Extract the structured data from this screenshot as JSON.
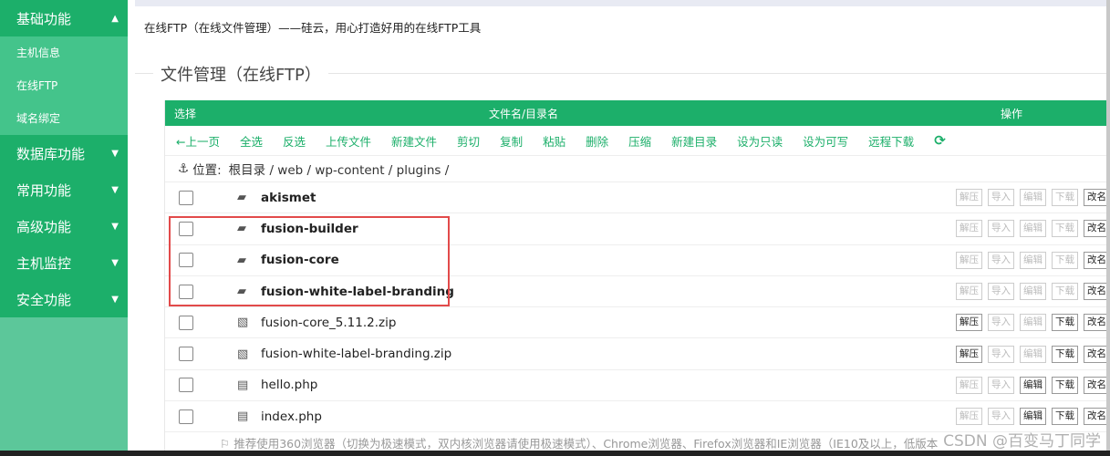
{
  "sidebar": {
    "active_header": "基础功能",
    "active_items": [
      "主机信息",
      "在线FTP",
      "域名绑定"
    ],
    "categories": [
      "数据库功能",
      "常用功能",
      "高级功能",
      "主机监控",
      "安全功能"
    ]
  },
  "page": {
    "title": "在线FTP（在线文件管理）——硅云，用心打造好用的在线FTP工具",
    "section_title": "文件管理（在线FTP）"
  },
  "table": {
    "header_select": "选择",
    "header_name": "文件名/目录名",
    "header_op": "操作"
  },
  "toolbar": [
    "←上一页",
    "全选",
    "反选",
    "上传文件",
    "新建文件",
    "剪切",
    "复制",
    "粘贴",
    "删除",
    "压缩",
    "新建目录",
    "设为只读",
    "设为可写",
    "远程下载"
  ],
  "path": {
    "icon": "anchor-icon",
    "label": "位置:",
    "value": "根目录 / web / wp-content / plugins /"
  },
  "files": [
    {
      "name": "akismet",
      "type": "folder",
      "icon": "folder-icon",
      "actions": [
        {
          "label": "解压",
          "enabled": false
        },
        {
          "label": "导入",
          "enabled": false
        },
        {
          "label": "编辑",
          "enabled": false
        },
        {
          "label": "下载",
          "enabled": false
        },
        {
          "label": "改名",
          "enabled": true
        }
      ]
    },
    {
      "name": "fusion-builder",
      "type": "folder",
      "icon": "folder-icon",
      "actions": [
        {
          "label": "解压",
          "enabled": false
        },
        {
          "label": "导入",
          "enabled": false
        },
        {
          "label": "编辑",
          "enabled": false
        },
        {
          "label": "下载",
          "enabled": false
        },
        {
          "label": "改名",
          "enabled": true
        }
      ]
    },
    {
      "name": "fusion-core",
      "type": "folder",
      "icon": "folder-icon",
      "actions": [
        {
          "label": "解压",
          "enabled": false
        },
        {
          "label": "导入",
          "enabled": false
        },
        {
          "label": "编辑",
          "enabled": false
        },
        {
          "label": "下载",
          "enabled": false
        },
        {
          "label": "改名",
          "enabled": true
        }
      ]
    },
    {
      "name": "fusion-white-label-branding",
      "type": "folder",
      "icon": "folder-icon",
      "actions": [
        {
          "label": "解压",
          "enabled": false
        },
        {
          "label": "导入",
          "enabled": false
        },
        {
          "label": "编辑",
          "enabled": false
        },
        {
          "label": "下载",
          "enabled": false
        },
        {
          "label": "改名",
          "enabled": true
        }
      ]
    },
    {
      "name": "fusion-core_5.11.2.zip",
      "type": "zip",
      "icon": "zip-file-icon",
      "actions": [
        {
          "label": "解压",
          "enabled": true
        },
        {
          "label": "导入",
          "enabled": false
        },
        {
          "label": "编辑",
          "enabled": false
        },
        {
          "label": "下载",
          "enabled": true
        },
        {
          "label": "改名",
          "enabled": true
        }
      ]
    },
    {
      "name": "fusion-white-label-branding.zip",
      "type": "zip",
      "icon": "zip-file-icon",
      "actions": [
        {
          "label": "解压",
          "enabled": true
        },
        {
          "label": "导入",
          "enabled": false
        },
        {
          "label": "编辑",
          "enabled": false
        },
        {
          "label": "下载",
          "enabled": true
        },
        {
          "label": "改名",
          "enabled": true
        }
      ]
    },
    {
      "name": "hello.php",
      "type": "file",
      "icon": "file-icon",
      "actions": [
        {
          "label": "解压",
          "enabled": false
        },
        {
          "label": "导入",
          "enabled": false
        },
        {
          "label": "编辑",
          "enabled": true
        },
        {
          "label": "下载",
          "enabled": true
        },
        {
          "label": "改名",
          "enabled": true
        }
      ]
    },
    {
      "name": "index.php",
      "type": "file",
      "icon": "file-icon",
      "actions": [
        {
          "label": "解压",
          "enabled": false
        },
        {
          "label": "导入",
          "enabled": false
        },
        {
          "label": "编辑",
          "enabled": true
        },
        {
          "label": "下载",
          "enabled": true
        },
        {
          "label": "改名",
          "enabled": true
        }
      ]
    }
  ],
  "notice": "推荐使用360浏览器（切换为极速模式，双内核浏览器请使用极速模式）、Chrome浏览器、Firefox浏览器和IE浏览器（IE10及以上，低版本",
  "watermark": "CSDN @百变马丁同学",
  "colors": {
    "accent": "#1caf6a",
    "sidebar": "#5cc79a",
    "highlight": "#e24a4a"
  }
}
